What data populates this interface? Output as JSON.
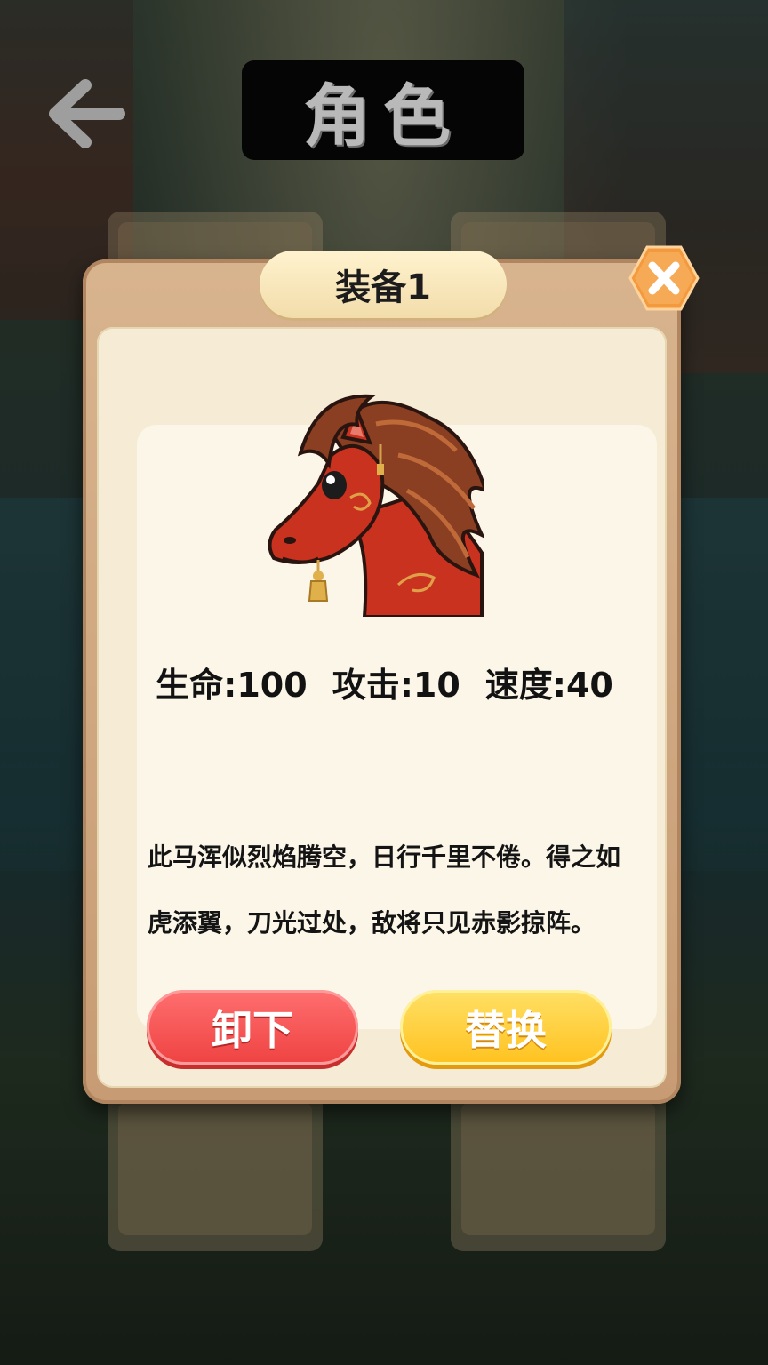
{
  "header": {
    "title": "角色",
    "back_icon": "arrow-left-icon"
  },
  "modal": {
    "name": "装备1",
    "close_icon": "close-icon",
    "item_image": "red-horse-icon",
    "stats": {
      "hp": "生命:100",
      "attack": "攻击:10",
      "speed": "速度:40"
    },
    "description": "此马浑似烈焰腾空，日行千里不倦。得之如虎添翼，刀光过处，敌将只见赤影掠阵。",
    "buttons": {
      "unequip": "卸下",
      "replace": "替换"
    }
  },
  "colors": {
    "unequip_button": "#ef4242",
    "replace_button": "#ffc21f",
    "close_button": "#f6a14b",
    "horse_body": "#c8321e",
    "horse_mane": "#8a3f22"
  }
}
